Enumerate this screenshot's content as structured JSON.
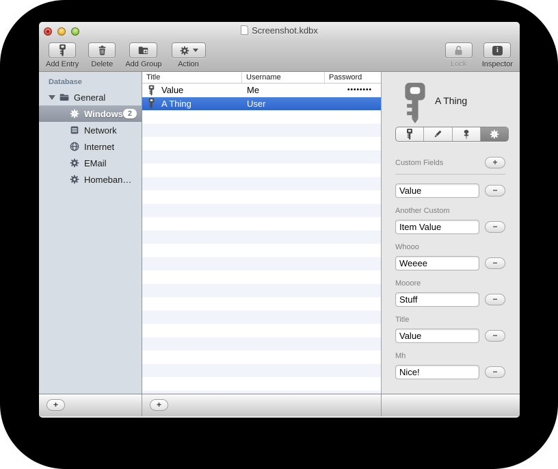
{
  "window": {
    "title": "Screenshot.kdbx"
  },
  "toolbar": {
    "add_entry": "Add Entry",
    "delete": "Delete",
    "add_group": "Add Group",
    "action": "Action",
    "lock": "Lock",
    "inspector": "Inspector"
  },
  "sidebar": {
    "header": "Database",
    "items": [
      {
        "label": "General",
        "icon": "folder"
      },
      {
        "label": "Windows",
        "icon": "gear",
        "badge": "2",
        "selected": true
      },
      {
        "label": "Network",
        "icon": "server"
      },
      {
        "label": "Internet",
        "icon": "globe"
      },
      {
        "label": "EMail",
        "icon": "gear"
      },
      {
        "label": "Homeban…",
        "icon": "gear"
      }
    ],
    "add_button": "+"
  },
  "table": {
    "columns": [
      "Title",
      "Username",
      "Password"
    ],
    "rows": [
      {
        "title": "Value",
        "username": "Me",
        "password": "••••••••",
        "selected": false
      },
      {
        "title": "A Thing",
        "username": "User",
        "password": "",
        "selected": true
      }
    ],
    "add_button": "+"
  },
  "inspector": {
    "entry_title": "A Thing",
    "tabs": [
      "key",
      "pencil",
      "pin",
      "gear"
    ],
    "selected_tab": "gear",
    "section_title": "Custom Fields",
    "add_button": "+",
    "remove_button": "−",
    "fields": [
      {
        "label": "",
        "value": "Value"
      },
      {
        "label": "Another Custom",
        "value": "Item Value"
      },
      {
        "label": "Whooo",
        "value": "Weeee"
      },
      {
        "label": "Mooore",
        "value": "Stuff"
      },
      {
        "label": "Title",
        "value": "Value"
      },
      {
        "label": "Mh",
        "value": "Nice!"
      }
    ]
  },
  "colors": {
    "selection_blue": "#3a76d8",
    "sidebar_bg": "#d6dde5",
    "row_stripe": "#f1f5fb",
    "inspector_bg": "#e7e7e7",
    "chrome_top": "#ededed",
    "chrome_bottom": "#b5b5b5"
  }
}
